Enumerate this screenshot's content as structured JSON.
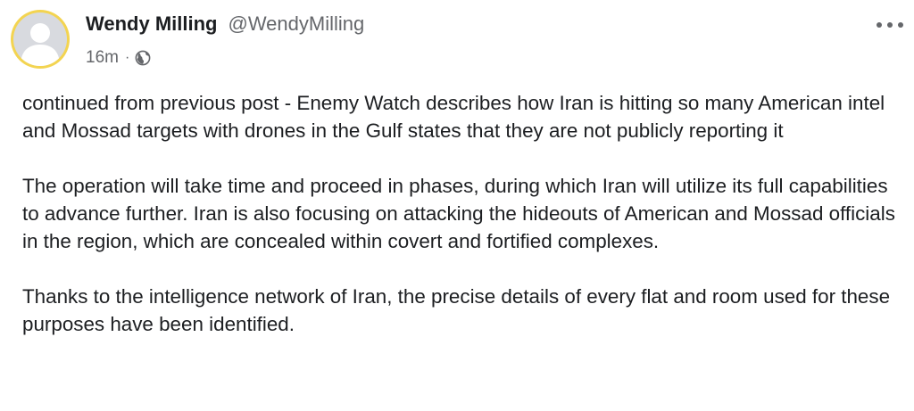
{
  "post": {
    "author_name": "Wendy Milling",
    "author_handle": "@WendyMilling",
    "timestamp": "16m",
    "meta_separator": "·",
    "privacy_icon": "globe-icon",
    "more_icon": "more-options-icon",
    "avatar_ring_color": "#f3d451",
    "paragraphs": [
      "continued from previous post - Enemy Watch describes how Iran is hitting so many American intel and Mossad targets with drones in the Gulf states that they are not publicly reporting it",
      "The operation will take time and proceed in phases, during which Iran will utilize its full capabilities to advance further. Iran is also focusing on attacking the hideouts of American and Mossad officials in the region, which are concealed within covert and fortified complexes.",
      "Thanks to the intelligence network of Iran, the precise details of every flat and room used for these purposes have been identified."
    ]
  }
}
